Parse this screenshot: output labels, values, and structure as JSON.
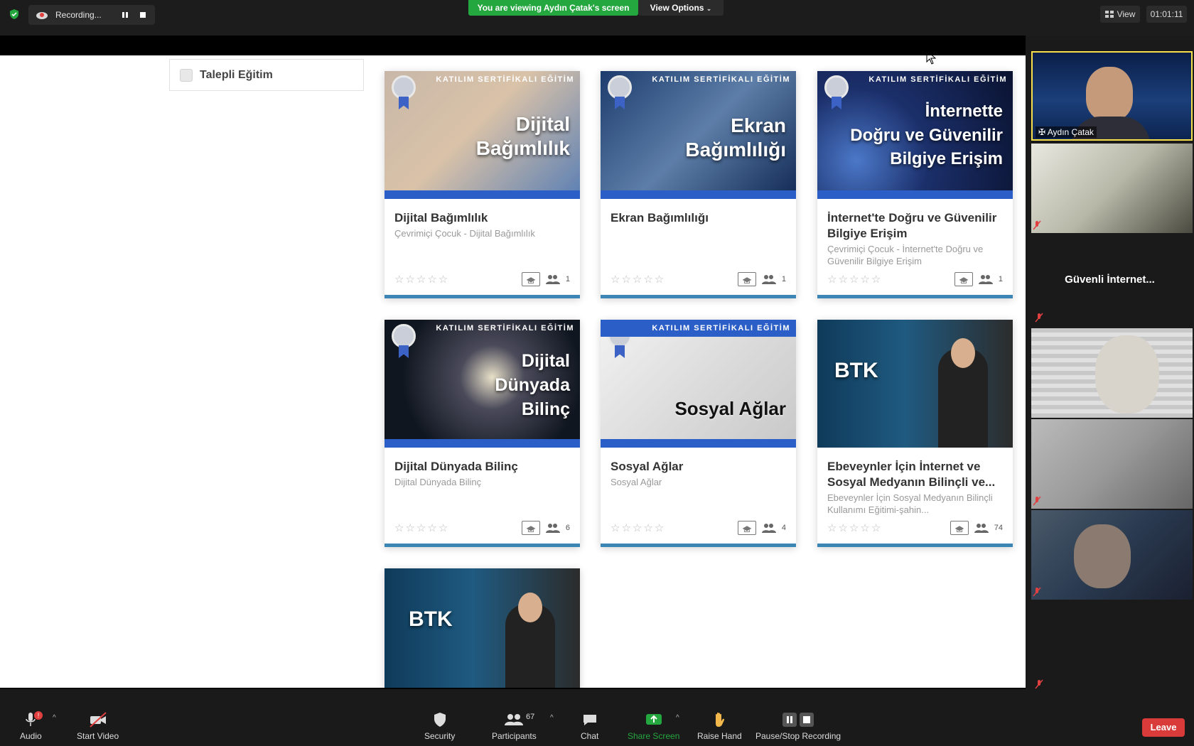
{
  "topbar": {
    "recording_label": "Recording...",
    "viewing_banner": "You are viewing Aydın Çatak's screen",
    "view_options_label": "View Options",
    "view_label": "View",
    "timer": "01:01:11"
  },
  "share": {
    "filter_label": "Talepli Eğitim",
    "cert_band": "KATILIM SERTİFİKALI EĞİTİM",
    "cards": [
      {
        "overlay": [
          "Dijital",
          "Bağımlılık"
        ],
        "title": "Dijital Bağımlılık",
        "subtitle": "Çevrimiçi Çocuk - Dijital Bağımlılık",
        "count": "1"
      },
      {
        "overlay": [
          "Ekran",
          "Bağımlılığı"
        ],
        "title": "Ekran Bağımlılığı",
        "subtitle": "",
        "count": "1"
      },
      {
        "overlay": [
          "İnternette",
          "Doğru ve Güvenilir",
          "Bilgiye Erişim"
        ],
        "title": "İnternet'te Doğru ve Güvenilir Bilgiye Erişim",
        "subtitle": "Çevrimiçi Çocuk - İnternet'te Doğru ve Güvenilir Bilgiye Erişim",
        "count": "1"
      },
      {
        "overlay": [
          "Dijital",
          "Dünyada",
          "Bilinç"
        ],
        "title": "Dijital Dünyada Bilinç",
        "subtitle": "Dijital Dünyada Bilinç",
        "count": "6"
      },
      {
        "overlay": [
          "Sosyal Ağlar"
        ],
        "title": "Sosyal Ağlar",
        "subtitle": "Sosyal Ağlar",
        "count": "4"
      },
      {
        "overlay": [
          "BTK"
        ],
        "title": "Ebeveynler İçin İnternet ve Sosyal Medyanın Bilinçli ve...",
        "subtitle": "Ebeveynler İçin Sosyal Medyanın Bilinçli Kullanımı Eğitimi-şahin...",
        "count": "74"
      },
      {
        "overlay": [
          "BTK"
        ],
        "title": "",
        "subtitle": "",
        "count": ""
      }
    ]
  },
  "gallery": {
    "active_name": "Aydın Çatak",
    "text_tile": "Güvenli  İnternet..."
  },
  "toolbar": {
    "audio": "Audio",
    "start_video": "Start Video",
    "security": "Security",
    "participants": "Participants",
    "participants_count": "67",
    "chat": "Chat",
    "share_screen": "Share Screen",
    "raise_hand": "Raise Hand",
    "pause_stop_recording": "Pause/Stop Recording",
    "leave": "Leave",
    "audio_alert": "!"
  },
  "colors": {
    "accent_green": "#25a740",
    "leave_red": "#d93a3a",
    "card_band_blue": "#2b5fc7",
    "active_tile_yellow": "#f7e04b"
  }
}
